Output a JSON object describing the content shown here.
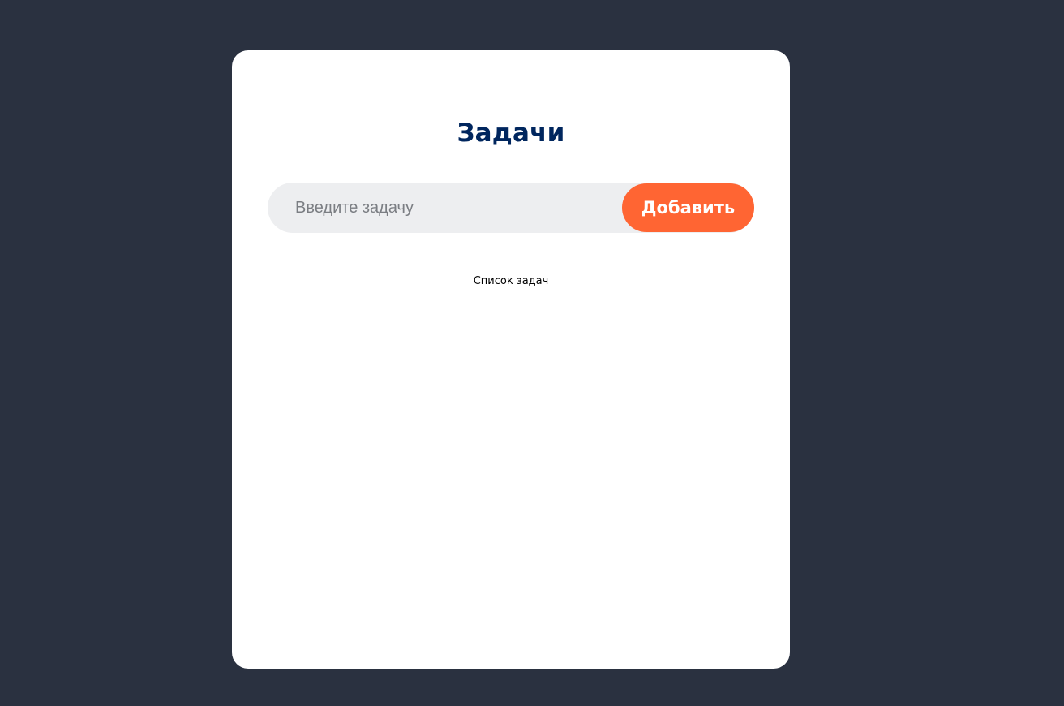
{
  "app": {
    "title": "Задачи",
    "input": {
      "value": "",
      "placeholder": "Введите задачу"
    },
    "add_button_label": "Добавить",
    "list_caption": "Список задач"
  },
  "colors": {
    "background": "#2a3140",
    "card": "#ffffff",
    "title": "#00265e",
    "input_bg": "#edeef0",
    "accent": "#ff6533"
  }
}
